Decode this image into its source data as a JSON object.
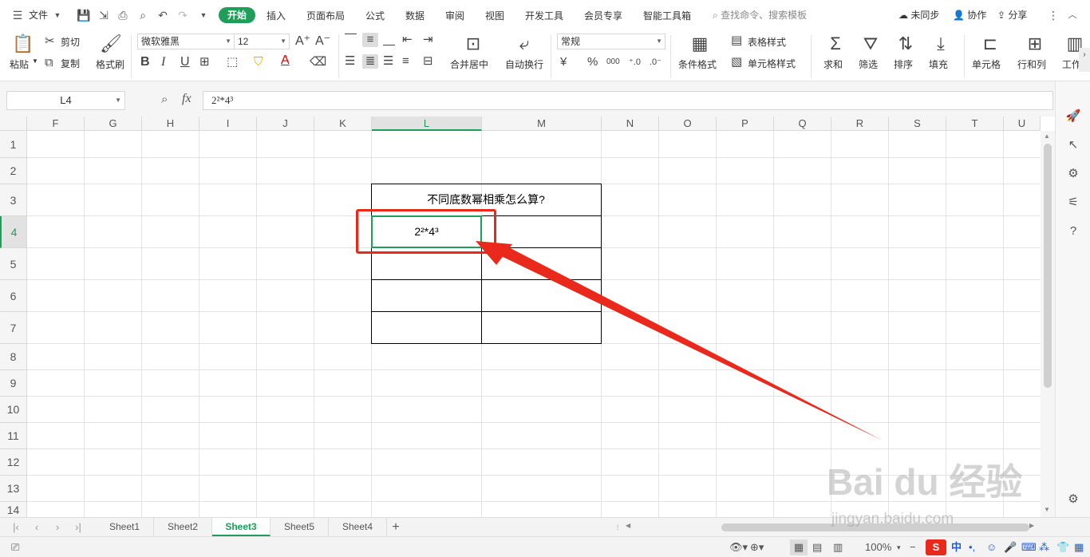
{
  "menubar": {
    "file_label": "文件",
    "tabs": [
      "开始",
      "插入",
      "页面布局",
      "公式",
      "数据",
      "审阅",
      "视图",
      "开发工具",
      "会员专享",
      "智能工具箱"
    ],
    "search_placeholder": "查找命令、搜索模板",
    "sync_label": "未同步",
    "collab_label": "协作",
    "share_label": "分享"
  },
  "ribbon": {
    "paste": "粘贴",
    "cut": "剪切",
    "copy": "复制",
    "format_painter": "格式刷",
    "font_name": "微软雅黑",
    "font_size": "12",
    "bold": "B",
    "italic": "I",
    "underline": "U",
    "merge_center": "合并居中",
    "wrap_text": "自动换行",
    "number_format": "常规",
    "currency": "¥",
    "percent": "%",
    "thousands": "000",
    "cond_format": "条件格式",
    "table_style": "表格样式",
    "cell_style": "单元格样式",
    "sum": "求和",
    "filter": "筛选",
    "sort": "排序",
    "fill": "填充",
    "cell": "单元格",
    "row_col": "行和列",
    "worksheet": "工作"
  },
  "formula_bar": {
    "name_box": "L4",
    "fx": "fx",
    "formula": "2²*4³"
  },
  "grid": {
    "columns": [
      "F",
      "G",
      "H",
      "I",
      "J",
      "K",
      "L",
      "M",
      "N",
      "O",
      "P",
      "Q",
      "R",
      "S",
      "T",
      "U"
    ],
    "rows": [
      "1",
      "2",
      "3",
      "4",
      "5",
      "6",
      "7",
      "8",
      "9",
      "10",
      "11",
      "12",
      "13",
      "14"
    ],
    "selected_column": "L",
    "selected_row": "4",
    "title_cell": "不同底数幂相乘怎么算?",
    "active_cell_value": "2²*4³"
  },
  "sheets": {
    "tabs": [
      "Sheet1",
      "Sheet2",
      "Sheet3",
      "Sheet5",
      "Sheet4"
    ],
    "active": "Sheet3",
    "add": "+"
  },
  "statusbar": {
    "zoom": "100%",
    "minus": "−",
    "ime": "中"
  },
  "watermark": {
    "brand": "Bai du 经验",
    "url": "jingyan.baidu.com"
  },
  "colors": {
    "accent": "#1f9d59",
    "annotation": "#e8291c"
  }
}
